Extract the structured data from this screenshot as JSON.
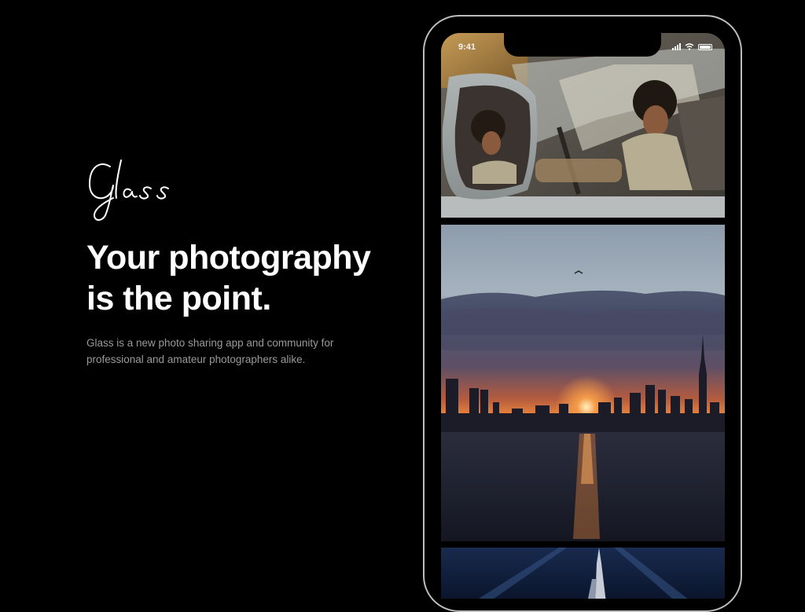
{
  "brand": {
    "logo_text": "Glass"
  },
  "hero": {
    "headline_line1": "Your photography",
    "headline_line2": "is the point.",
    "description_line1": "Glass is a new photo sharing app and community for",
    "description_line2": "professional and amateur photographers alike."
  },
  "phone": {
    "status_time": "9:41",
    "photos": [
      {
        "subject": "woman in car reflected in side mirror"
      },
      {
        "subject": "city skyline at sunset over water"
      },
      {
        "subject": "illuminated skyscraper at night"
      }
    ]
  },
  "colors": {
    "background": "#000000",
    "text": "#ffffff",
    "muted_text": "#9a9a9a",
    "phone_frame": "#bdbdbd"
  }
}
